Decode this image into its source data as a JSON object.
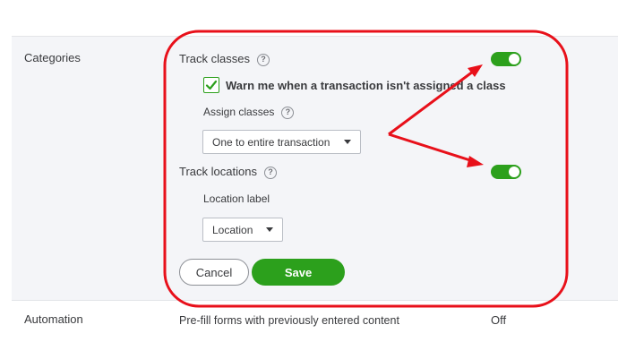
{
  "categories": {
    "section_label": "Categories",
    "track_classes_label": "Track classes",
    "warn_checkbox_label": "Warn me when a transaction isn't assigned a class",
    "warn_checked": true,
    "assign_classes_label": "Assign classes",
    "assign_classes_value": "One to entire transaction",
    "track_locations_label": "Track locations",
    "location_label_label": "Location label",
    "location_label_value": "Location",
    "track_classes_on": true,
    "track_locations_on": true,
    "help_glyph": "?"
  },
  "actions": {
    "cancel_label": "Cancel",
    "save_label": "Save"
  },
  "automation": {
    "section_label": "Automation",
    "prefill_text": "Pre-fill forms with previously entered content",
    "prefill_value": "Off"
  },
  "colors": {
    "accent_green": "#2ca01c",
    "annotation_red": "#e8101a",
    "panel_bg": "#f4f5f8"
  },
  "icons": {
    "help": "help-circle-icon",
    "check": "checkmark-icon",
    "caret": "chevron-down-icon"
  }
}
